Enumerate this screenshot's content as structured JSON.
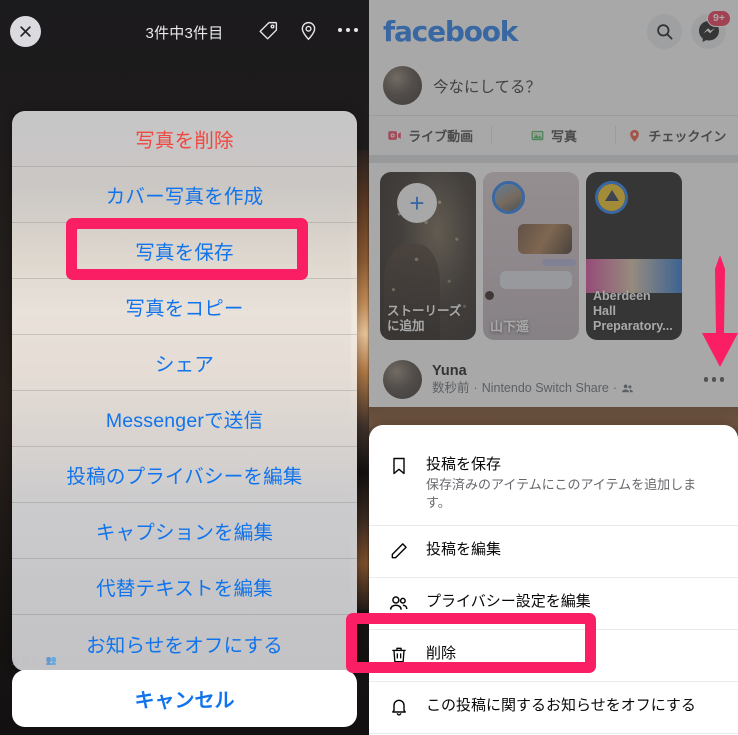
{
  "left_panel": {
    "close_icon": "close-x-icon",
    "counter": "3件中3件目",
    "toolbar_icons": [
      "tag-icon",
      "location-pin-icon",
      "more-dots-icon"
    ],
    "action_sheet": {
      "items": [
        {
          "label": "写真を削除",
          "style": "destructive"
        },
        {
          "label": "カバー写真を作成",
          "style": "default"
        },
        {
          "label": "写真を保存",
          "style": "default",
          "highlighted": true
        },
        {
          "label": "写真をコピー",
          "style": "default"
        },
        {
          "label": "シェア",
          "style": "default"
        },
        {
          "label": "Messengerで送信",
          "style": "default"
        },
        {
          "label": "投稿のプライバシーを編集",
          "style": "default"
        },
        {
          "label": "キャプションを編集",
          "style": "default"
        },
        {
          "label": "代替テキストを編集",
          "style": "default"
        },
        {
          "label": "お知らせをオフにする",
          "style": "default"
        }
      ],
      "cancel_label": "キャンセル"
    },
    "ghost_meta": "数秒前"
  },
  "right_panel": {
    "header": {
      "logo": "facebook",
      "search_icon": "search-icon",
      "messenger_icon": "messenger-icon",
      "messenger_badge": "9+"
    },
    "composer": {
      "avatar": "user-avatar",
      "placeholder": "今なにしてる？",
      "buttons": [
        {
          "label": "ライブ動画",
          "icon": "live-video-icon",
          "color": "#f3425f"
        },
        {
          "label": "写真",
          "icon": "photo-icon",
          "color": "#41b35d"
        },
        {
          "label": "チェックイン",
          "icon": "location-pin-icon",
          "color": "#f5533d"
        }
      ]
    },
    "stories": [
      {
        "label": "ストーリーズに追加",
        "type": "add-story"
      },
      {
        "label": "山下遥",
        "type": "story"
      },
      {
        "label": "Aberdeen Hall Preparatory...",
        "type": "story"
      }
    ],
    "post": {
      "author": "Yuna",
      "time": "数秒前",
      "source": "Nintendo Switch Share",
      "audience_icon": "friends-icon",
      "menu_icon": "more-dots-icon"
    },
    "bottom_sheet": {
      "items": [
        {
          "title": "投稿を保存",
          "subtitle": "保存済みのアイテムにこのアイテムを追加します。",
          "icon": "bookmark-icon"
        },
        {
          "title": "投稿を編集",
          "subtitle": "",
          "icon": "pencil-icon"
        },
        {
          "title": "プライバシー設定を編集",
          "subtitle": "",
          "icon": "friends-icon"
        },
        {
          "title": "削除",
          "subtitle": "",
          "icon": "trash-icon",
          "highlighted": true
        },
        {
          "title": "この投稿に関するお知らせをオフにする",
          "subtitle": "",
          "icon": "bell-icon"
        }
      ]
    }
  },
  "annotations": {
    "highlight_color": "#fa1e64",
    "arrow_icon": "arrow-down-icon"
  }
}
